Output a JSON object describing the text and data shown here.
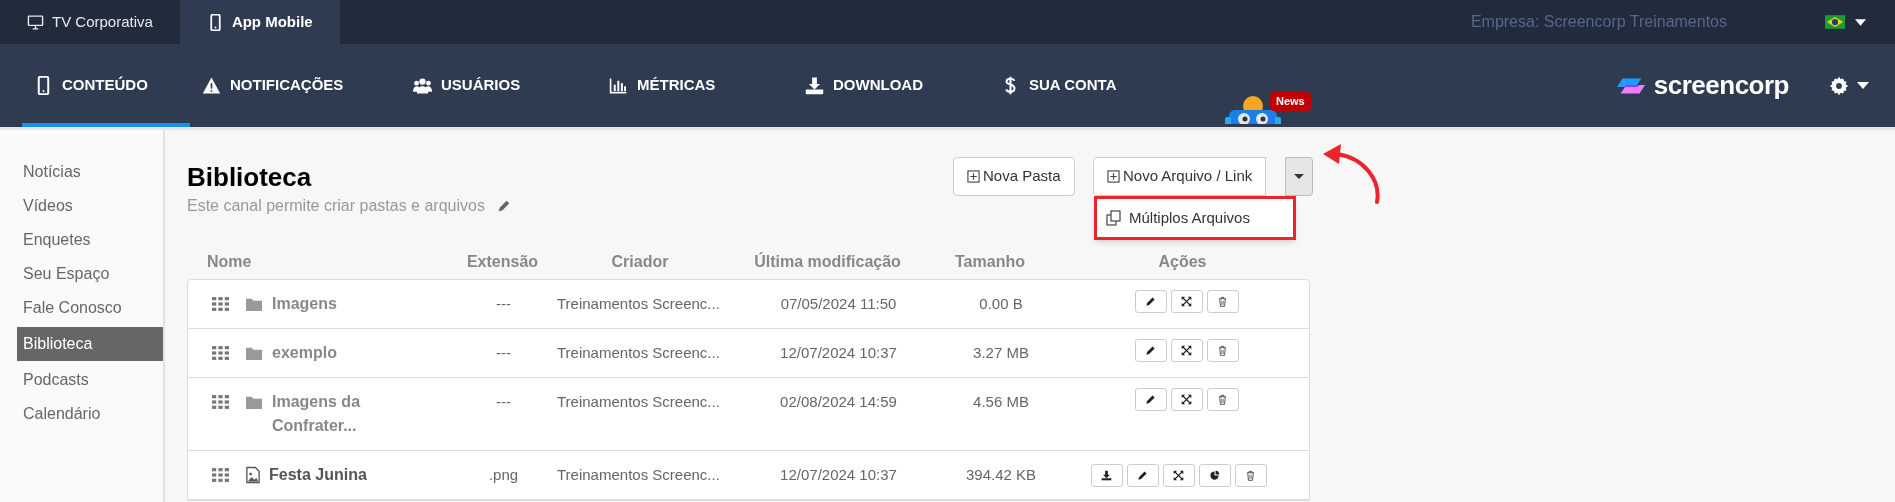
{
  "top_tabs": [
    {
      "label": "TV Corporativa",
      "kind": "monitor",
      "selected": false
    },
    {
      "label": "App Mobile",
      "kind": "phone",
      "selected": true
    }
  ],
  "company": "Empresa: Screencorp Treinamentos",
  "nav": [
    {
      "label": "CONTEÚDO",
      "kind": "phone",
      "selected": true
    },
    {
      "label": "NOTIFICAÇÕES",
      "kind": "warning",
      "selected": false
    },
    {
      "label": "USUÁRIOS",
      "kind": "users",
      "selected": false
    },
    {
      "label": "MÉTRICAS",
      "kind": "chart",
      "selected": false
    },
    {
      "label": "DOWNLOAD",
      "kind": "download",
      "selected": false
    },
    {
      "label": "SUA CONTA",
      "kind": "dollar",
      "selected": false
    }
  ],
  "news_badge": "News",
  "logo": "screencorp",
  "sidebar": [
    {
      "label": "Notícias",
      "selected": false
    },
    {
      "label": "Vídeos",
      "selected": false
    },
    {
      "label": "Enquetes",
      "selected": false
    },
    {
      "label": "Seu Espaço",
      "selected": false
    },
    {
      "label": "Fale Conosco",
      "selected": false
    },
    {
      "label": "Biblioteca",
      "selected": true
    },
    {
      "label": "Podcasts",
      "selected": false
    },
    {
      "label": "Calendário",
      "selected": false
    }
  ],
  "title": "Biblioteca",
  "subtitle": "Este canal permite criar pastas e arquivos",
  "buttons": {
    "new_folder": "Nova Pasta",
    "new_file": "Novo Arquivo / Link"
  },
  "dropdown": {
    "items": [
      "Múltiplos Arquivos"
    ]
  },
  "table": {
    "columns": [
      "Nome",
      "Extensão",
      "Criador",
      "Última modificação",
      "Tamanho",
      "Ações"
    ],
    "rows": [
      {
        "kind": "folder",
        "name": "Imagens",
        "extension": "---",
        "creator": "Treinamentos Screenc...",
        "modified": "07/05/2024 11:50",
        "size": "0.00 B"
      },
      {
        "kind": "folder",
        "name": "exemplo",
        "extension": "---",
        "creator": "Treinamentos Screenc...",
        "modified": "12/07/2024 10:37",
        "size": "3.27 MB"
      },
      {
        "kind": "folder",
        "name": "Imagens da Confrater...",
        "extension": "---",
        "creator": "Treinamentos Screenc...",
        "modified": "02/08/2024 14:59",
        "size": "4.56 MB"
      },
      {
        "kind": "image",
        "name": "Festa Junina",
        "extension": ".png",
        "creator": "Treinamentos Screenc...",
        "modified": "12/07/2024 10:37",
        "size": "394.42 KB"
      }
    ]
  }
}
